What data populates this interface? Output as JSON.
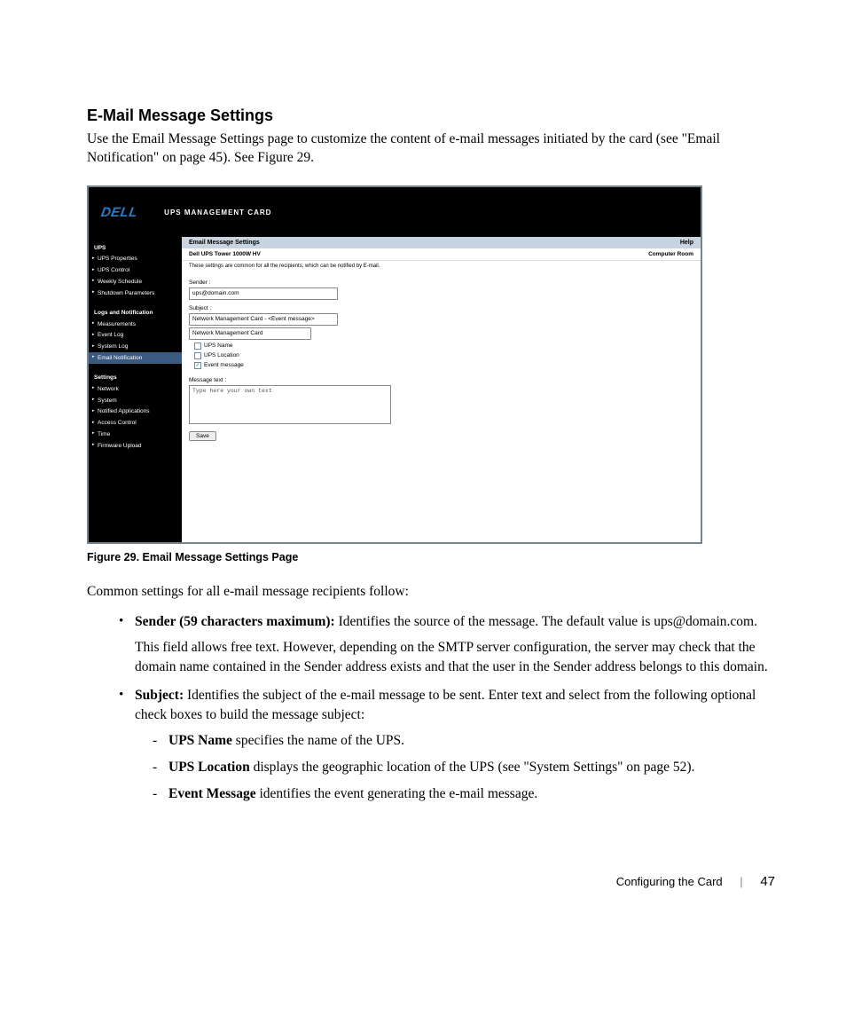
{
  "doc": {
    "section_title": "E-Mail Message Settings",
    "intro": "Use the Email Message Settings page to customize the content of e-mail messages initiated by the card (see \"Email Notification\" on page 45). See Figure 29.",
    "figure_caption": "Figure 29. Email Message Settings Page",
    "common_intro": "Common settings for all e-mail message recipients follow:",
    "bullet1_label": "Sender (59 characters maximum):",
    "bullet1_text": " Identifies the source of the message. The default value is ups@domain.com.",
    "bullet1_para2": "This field allows free text. However, depending on the SMTP server configuration, the server may check that the domain name contained in the Sender address exists and that the user in the Sender address belongs to this domain.",
    "bullet2_label": "Subject:",
    "bullet2_text": " Identifies the subject of the e-mail message to be sent. Enter text and select from the following optional check boxes to build the message subject:",
    "sub1_label": "UPS Name",
    "sub1_text": " specifies the name of the UPS.",
    "sub2_label": "UPS Location",
    "sub2_text": " displays the geographic location of the UPS (see \"System Settings\" on page 52).",
    "sub3_label": "Event Message",
    "sub3_text": " identifies the event generating the e-mail message.",
    "footer_text": "Configuring the Card",
    "page_number": "47"
  },
  "app": {
    "logo": "DELL",
    "header_title": "UPS MANAGEMENT CARD",
    "nav": {
      "ups_title": "UPS",
      "ups_items": [
        "UPS Properties",
        "UPS Control",
        "Weekly Schedule",
        "Shutdown Parameters"
      ],
      "logs_title": "Logs and Notification",
      "logs_items": [
        "Measurements",
        "Event Log",
        "System Log",
        "Email Notification"
      ],
      "settings_title": "Settings",
      "settings_items": [
        "Network",
        "System",
        "Notified Applications",
        "Access Control",
        "Time",
        "Firmware Upload"
      ]
    },
    "content": {
      "header_left": "Email Message Settings",
      "header_right": "Help",
      "sub_left": "Dell UPS Tower 1000W HV",
      "sub_right": "Computer Room",
      "note": "These settings are common for all the recipients, which can be notified by E-mail.",
      "sender_label": "Sender :",
      "sender_value": "ups@domain.com",
      "subject_label": "Subject :",
      "subject_value": "Network Management Card - <Event message>",
      "subject_input2": "Network Management Card",
      "cb_ups_name": "UPS Name",
      "cb_ups_location": "UPS Location",
      "cb_event_message": "Event message",
      "message_label": "Message text :",
      "message_placeholder": "Type here your own text",
      "save_btn": "Save"
    }
  }
}
